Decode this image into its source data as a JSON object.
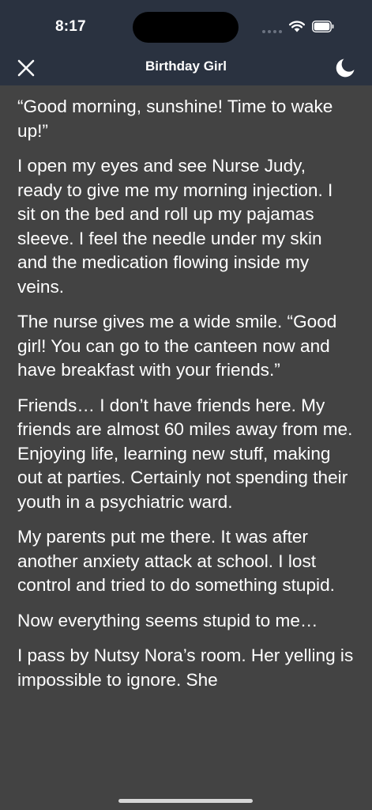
{
  "status_bar": {
    "time": "8:17",
    "icons": [
      "signal-dots-icon",
      "wifi-icon",
      "battery-icon"
    ]
  },
  "nav": {
    "title": "Birthday Girl",
    "close_icon": "close-icon",
    "theme_icon": "moon-icon"
  },
  "story": {
    "paragraphs": [
      "“Good morning, sunshine! Time to wake up!”",
      "I open my eyes and see Nurse Judy, ready to give me my morning injection. I sit on the bed and roll up my pajamas sleeve. I feel the needle under my skin and the medication flowing inside my veins.",
      "The nurse gives me a wide smile. “Good girl! You can go to the canteen now and have breakfast with your friends.”",
      "Friends… I don’t have friends here. My friends are almost 60 miles away from me. Enjoying life, learning new stuff, making out at parties. Certainly not spending their youth in a psychiatric ward.",
      "My parents put me there. It was after another anxiety attack at school. I lost control and tried to do something stupid.",
      "Now everything seems stupid to me…",
      "I pass by Nutsy Nora’s room. Her yelling is impossible to ignore. She"
    ]
  },
  "colors": {
    "header_bg": "#2a3240",
    "content_bg": "#434343",
    "text": "#ffffff"
  }
}
